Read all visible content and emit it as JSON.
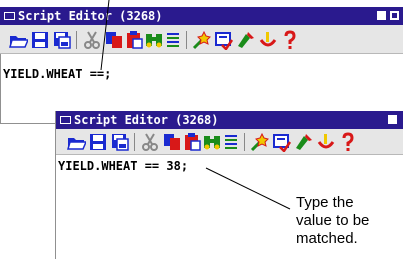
{
  "back_window": {
    "title": "Script Editor (3268)",
    "code": "YIELD.WHEAT ==;"
  },
  "front_window": {
    "title": "Script Editor (3268)",
    "code": "YIELD.WHEAT == 38;"
  },
  "toolbar_icons": [
    "open-icon",
    "save-icon",
    "save-as-icon",
    "cut-icon",
    "copy-icon",
    "paste-icon",
    "find-icon",
    "find-replace-icon",
    "run-icon",
    "check-syntax-icon",
    "insert-icon",
    "debug-icon",
    "help-icon"
  ],
  "callout": {
    "line1": "Type the",
    "line2": "value to be",
    "line3": "matched."
  },
  "colors": {
    "titlebar": "#2a1a8e",
    "toolbar": "#e6e6e6",
    "icon_blue": "#1a2ad0",
    "icon_red": "#d81818",
    "icon_yellow": "#f0c800",
    "icon_green": "#1a8c1a"
  }
}
